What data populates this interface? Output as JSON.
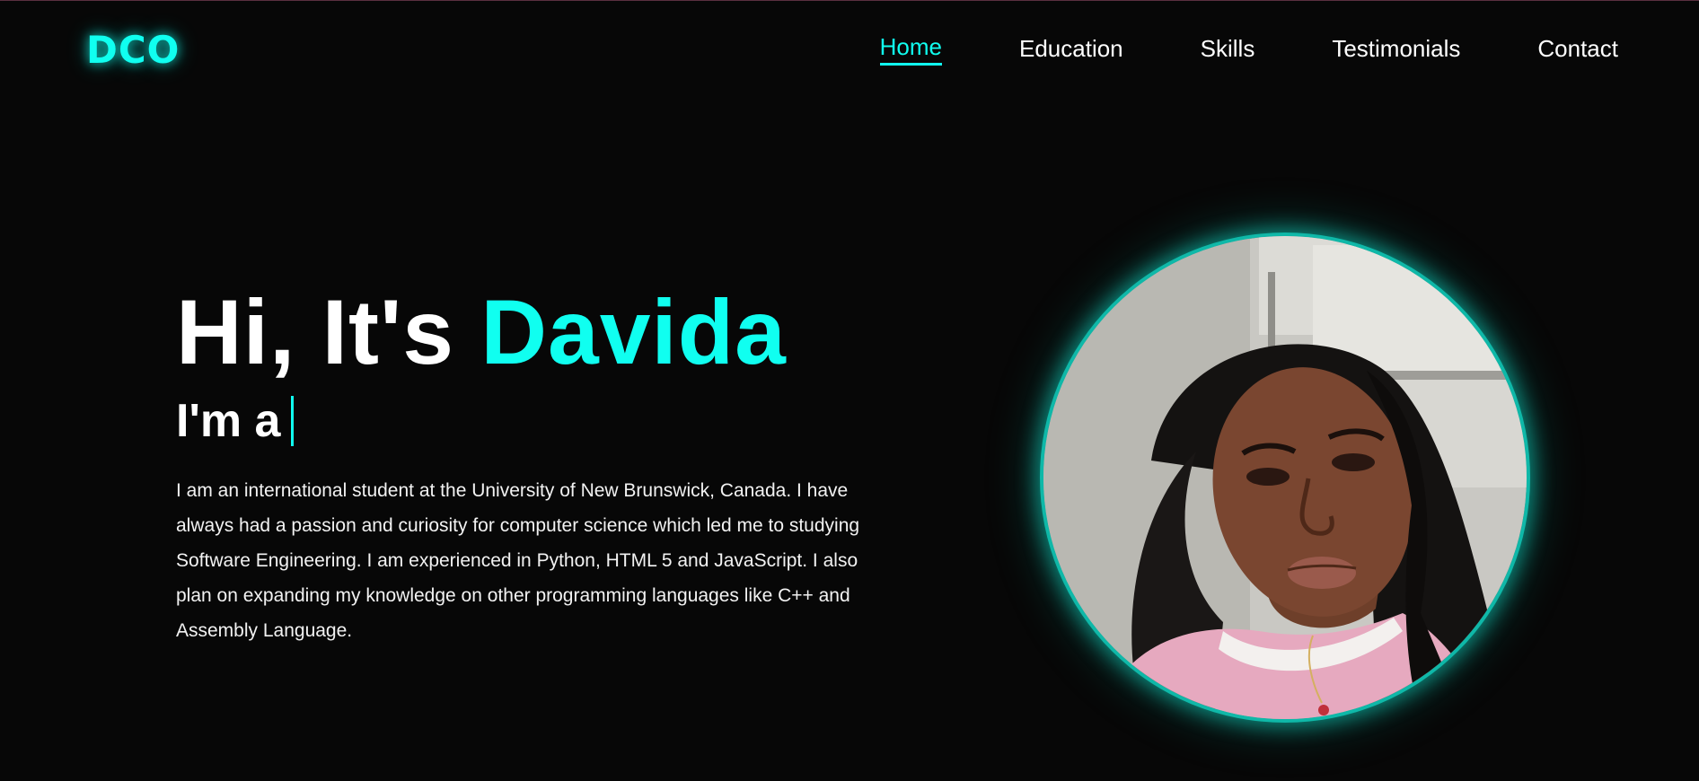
{
  "header": {
    "logo": "DCO",
    "nav": [
      {
        "label": "Home",
        "active": true
      },
      {
        "label": "Education",
        "active": false
      },
      {
        "label": "Skills",
        "active": false
      },
      {
        "label": "Testimonials",
        "active": false
      },
      {
        "label": "Contact",
        "active": false
      }
    ]
  },
  "hero": {
    "greeting": "Hi, It's",
    "name": "Davida",
    "role_prefix": "I'm a",
    "bio": "I am an international student at the University of New Brunswick, Canada. I have always had a passion and curiosity for computer science which led me to studying Software Engineering. I am experienced in Python, HTML 5 and JavaScript. I also plan on expanding my knowledge on other programming languages like C++ and Assembly Language."
  },
  "colors": {
    "accent": "#10fff0",
    "background": "#070707",
    "text": "#ffffff"
  }
}
